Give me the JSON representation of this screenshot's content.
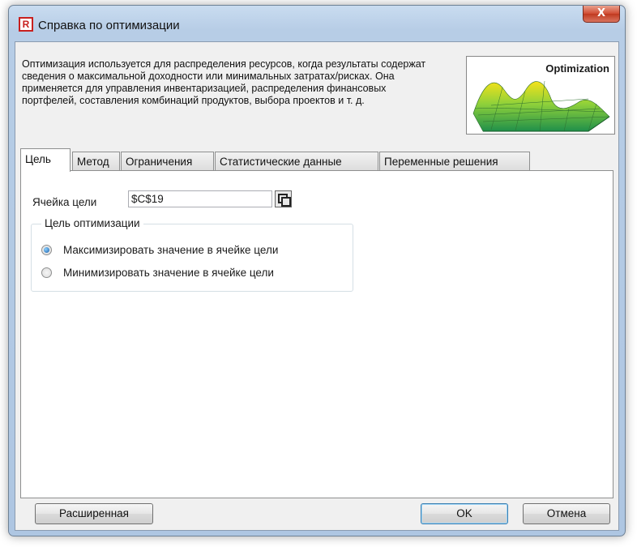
{
  "window": {
    "title": "Справка по оптимизации",
    "close_glyph": "X",
    "app_icon_letter": "R"
  },
  "intro_text": "Оптимизация используется для распределения ресурсов, когда результаты содержат сведения о максимальной доходности или минимальных затратах/рисках. Она применяется для управления инвентаризацией, распределения финансовых портфелей, составления комбинаций продуктов, выбора проектов и т. д.",
  "illustration_label": "Optimization",
  "tabs": [
    {
      "label": "Цель",
      "active": true
    },
    {
      "label": "Метод",
      "active": false
    },
    {
      "label": "Ограничения",
      "active": false
    },
    {
      "label": "Статистические данные",
      "active": false
    },
    {
      "label": "Переменные решения",
      "active": false
    }
  ],
  "goal_cell": {
    "label": "Ячейка цели",
    "value": "$C$19"
  },
  "goal_group": {
    "title": "Цель оптимизации",
    "options": [
      {
        "label": "Максимизировать значение в ячейке цели",
        "selected": true
      },
      {
        "label": "Минимизировать значение в ячейке цели",
        "selected": false
      }
    ]
  },
  "buttons": {
    "advanced": "Расширенная",
    "ok": "OK",
    "cancel": "Отмена"
  },
  "icons": {
    "app": "app-r-icon",
    "close": "close-icon",
    "cell_ref": "cell-reference-icon"
  },
  "colors": {
    "app_icon_red": "#c8201e",
    "close_red": "#c7412a",
    "selection_blue": "#1d5fa8"
  }
}
